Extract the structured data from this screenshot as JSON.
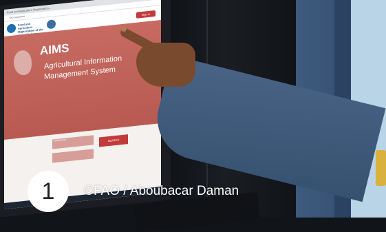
{
  "photo": {
    "screen": {
      "tab_text": "Food and Agriculture Organization...",
      "address_text": "fao.org/aims",
      "org_name": "Food and Agriculture Organization of the United Nations",
      "sign_in_label": "Sign in",
      "title": "AIMS",
      "subtitle": "Agricultural Information Management System",
      "field1_label": "AgriRefinings",
      "field2_label": "",
      "search_label": "SEARCH"
    }
  },
  "caption": {
    "number": "1",
    "credit": "©FAO / Aboubacar Daman"
  }
}
